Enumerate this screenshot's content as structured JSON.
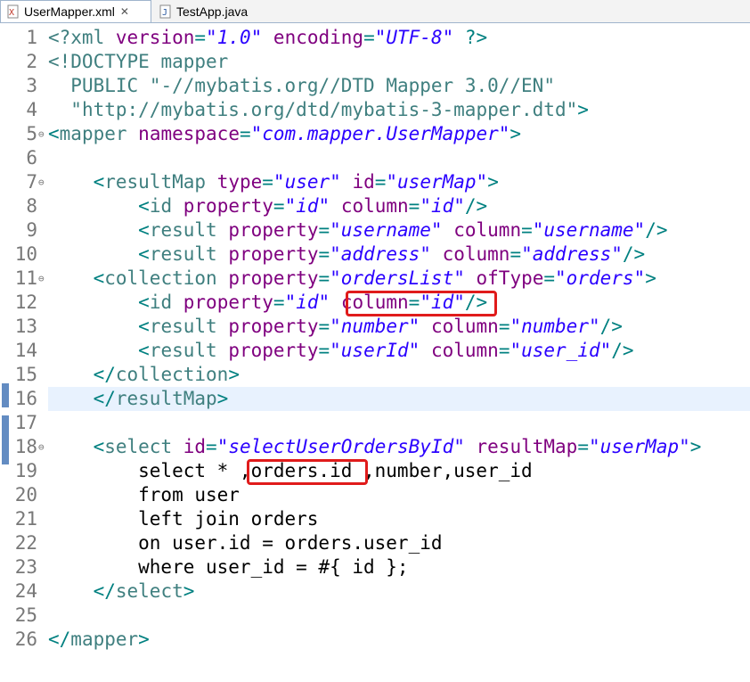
{
  "tabs": [
    {
      "label": "UserMapper.xml",
      "active": true,
      "icon": "xml-file-icon"
    },
    {
      "label": "TestApp.java",
      "active": false,
      "icon": "java-file-icon"
    }
  ],
  "editor": {
    "cursor_line": 16,
    "folded_markers": [
      5,
      7,
      11,
      18
    ],
    "highlights": [
      {
        "line": 12,
        "text": "column=\"id\"/>"
      },
      {
        "line": 19,
        "text": ",orders.id"
      }
    ],
    "lines": [
      {
        "n": "1",
        "text": "<?xml version=\"1.0\" encoding=\"UTF-8\" ?>"
      },
      {
        "n": "2",
        "text": "<!DOCTYPE mapper"
      },
      {
        "n": "3",
        "text": "  PUBLIC \"-//mybatis.org//DTD Mapper 3.0//EN\""
      },
      {
        "n": "4",
        "text": "  \"http://mybatis.org/dtd/mybatis-3-mapper.dtd\">"
      },
      {
        "n": "5",
        "text": "<mapper namespace=\"com.mapper.UserMapper\">"
      },
      {
        "n": "6",
        "text": ""
      },
      {
        "n": "7",
        "text": "    <resultMap type=\"user\" id=\"userMap\">"
      },
      {
        "n": "8",
        "text": "        <id property=\"id\" column=\"id\"/>"
      },
      {
        "n": "9",
        "text": "        <result property=\"username\" column=\"username\"/>"
      },
      {
        "n": "10",
        "text": "        <result property=\"address\" column=\"address\"/>"
      },
      {
        "n": "11",
        "text": "    <collection property=\"ordersList\" ofType=\"orders\">"
      },
      {
        "n": "12",
        "text": "        <id property=\"id\" column=\"id\"/>"
      },
      {
        "n": "13",
        "text": "        <result property=\"number\" column=\"number\"/>"
      },
      {
        "n": "14",
        "text": "        <result property=\"userId\" column=\"user_id\"/>"
      },
      {
        "n": "15",
        "text": "    </collection>"
      },
      {
        "n": "16",
        "text": "    </resultMap>"
      },
      {
        "n": "17",
        "text": ""
      },
      {
        "n": "18",
        "text": "    <select id=\"selectUserOrdersById\" resultMap=\"userMap\">"
      },
      {
        "n": "19",
        "text": "        select * ,orders.id ,number,user_id"
      },
      {
        "n": "20",
        "text": "        from user"
      },
      {
        "n": "21",
        "text": "        left join orders"
      },
      {
        "n": "22",
        "text": "        on user.id = orders.user_id"
      },
      {
        "n": "23",
        "text": "        where user_id = #{ id };"
      },
      {
        "n": "24",
        "text": "    </select>"
      },
      {
        "n": "25",
        "text": ""
      },
      {
        "n": "26",
        "text": "</mapper>"
      }
    ]
  }
}
